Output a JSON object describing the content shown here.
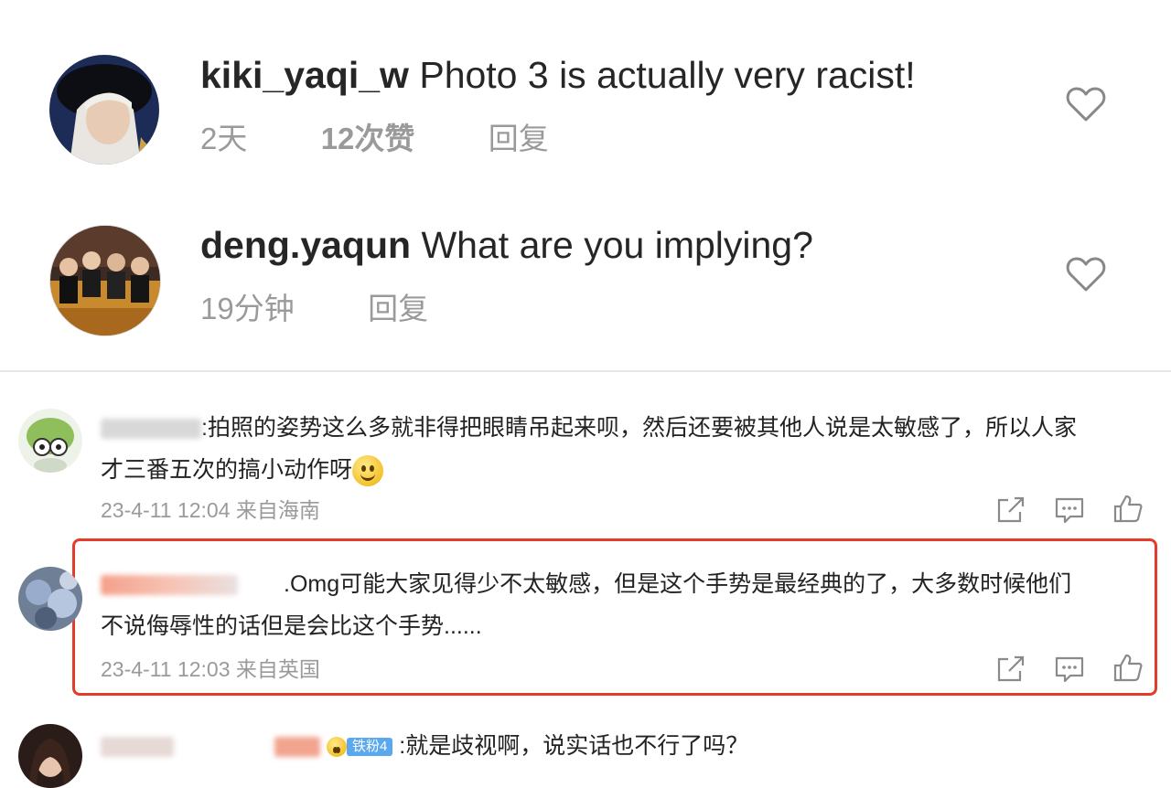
{
  "ig_comments": [
    {
      "username": "kiki_yaqi_w",
      "text": "Photo 3 is actually very racist!",
      "time": "2天",
      "likes": "12次赞",
      "reply": "回复"
    },
    {
      "username": "deng.yaqun",
      "text": "What are you implying?",
      "time": "19分钟",
      "reply": "回复"
    }
  ],
  "weibo_comments": [
    {
      "text_line1": ":拍照的姿势这么多就非得把眼睛吊起来呗，然后还要被其他人说是太敏感了，所以人家",
      "text_line2": "才三番五次的搞小动作呀",
      "meta": "23-4-11 12:04 来自海南",
      "emoji": "smile-emoji"
    },
    {
      "text_line1": ".Omg可能大家见得少不太敏感，但是这个手势是最经典的了，大多数时候他们",
      "text_line2": "不说侮辱性的话但是会比这个手势......",
      "meta": "23-4-11 12:03 来自英国"
    },
    {
      "badge": "铁粉4",
      "text_line1": ":就是歧视啊，说实话也不行了吗？"
    }
  ],
  "colors": {
    "highlight_border": "#e53b2c",
    "meta_gray": "#9a9a9a",
    "badge_blue": "#5aa9f0"
  },
  "icons": [
    "heart-icon",
    "share-icon",
    "comment-icon",
    "thumbs-up-icon"
  ]
}
